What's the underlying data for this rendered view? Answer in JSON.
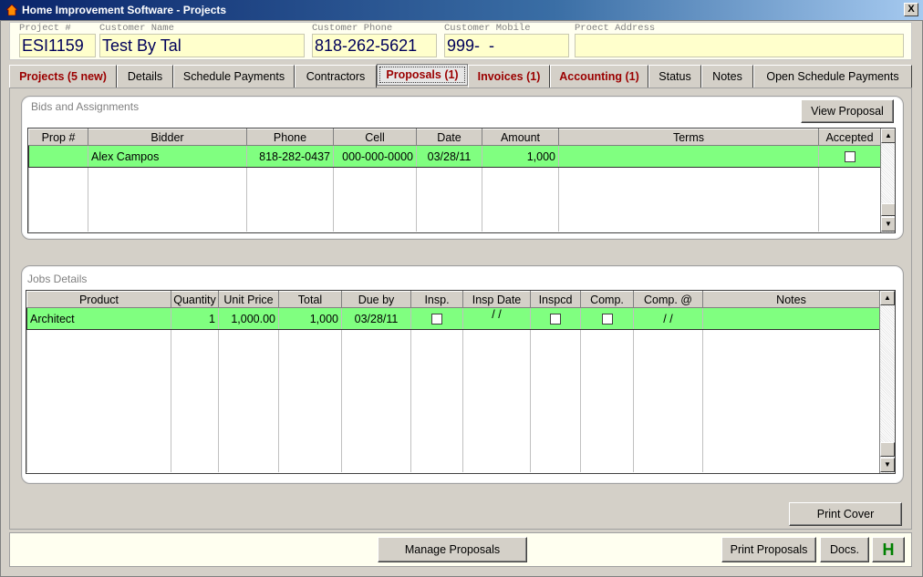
{
  "window": {
    "title": "Home Improvement Software - Projects",
    "close_glyph": "X"
  },
  "header": {
    "project_label": "Project #",
    "project_value": "ESI1159",
    "name_label": "Customer Name",
    "name_value": "Test By Tal",
    "phone_label": "Customer Phone",
    "phone_value": "818-262-5621",
    "mobile_label": "Customer Mobile",
    "mobile_value": "999-  -",
    "address_label": "Proect Address",
    "address_value": ""
  },
  "tabs": [
    "Projects (5 new)",
    "Details",
    "Schedule Payments",
    "Contractors",
    "Proposals (1)",
    "Invoices (1)",
    "Accounting (1)",
    "Status",
    "Notes",
    "Open Schedule Payments"
  ],
  "bids": {
    "title": "Bids and Assignments",
    "view_button": "View Proposal",
    "columns": [
      "Prop #",
      "Bidder",
      "Phone",
      "Cell",
      "Date",
      "Amount",
      "Terms",
      "Accepted"
    ],
    "rows": [
      {
        "prop": "",
        "bidder": "Alex Campos",
        "phone": "818-282-0437",
        "cell": "000-000-0000",
        "date": "03/28/11",
        "amount": "1,000",
        "terms": "",
        "accepted": false
      }
    ]
  },
  "jobs": {
    "title": "Jobs Details",
    "columns": [
      "Product",
      "Quantity",
      "Unit Price",
      "Total",
      "Due by",
      "Insp.",
      "Insp Date",
      "Inspcd",
      "Comp.",
      "Comp. @",
      "Notes"
    ],
    "rows": [
      {
        "product": "Architect",
        "quantity": "1",
        "unit_price": "1,000.00",
        "total": "1,000",
        "due_by": "03/28/11",
        "insp": false,
        "insp_date": "/ /",
        "inspcd": false,
        "comp": false,
        "comp_at": "/ /",
        "notes": ""
      }
    ]
  },
  "buttons": {
    "print_cover": "Print Cover",
    "manage_proposals": "Manage Proposals",
    "print_proposals": "Print Proposals",
    "docs": "Docs.",
    "h": "H"
  },
  "colors": {
    "selected_row": "#80ff80",
    "tab_red": "#9b0000",
    "h_green": "#008000"
  }
}
